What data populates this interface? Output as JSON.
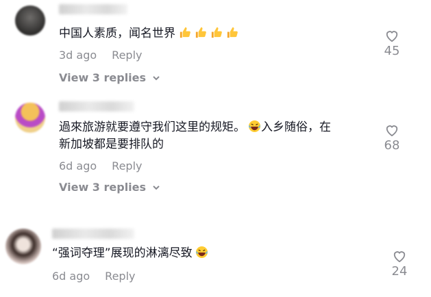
{
  "comments": [
    {
      "text": "中国人素质，闻名世界",
      "time": "3d ago",
      "reply_label": "Reply",
      "likes": "45",
      "view_replies": "View 3 replies",
      "emoji": "thumbs-up x4"
    },
    {
      "text_line1": "過來旅游就要遵守我们这里的规矩。",
      "text_line1b": "入乡随俗，在",
      "text_line2": "新加坡都是要排队的",
      "time": "6d ago",
      "reply_label": "Reply",
      "likes": "68",
      "view_replies": "View 3 replies",
      "emoji": "laughing-face"
    },
    {
      "text": "“强词夺理”展现的淋漓尽致",
      "time": "6d ago",
      "reply_label": "Reply",
      "likes": "24",
      "emoji": "laughing-face"
    }
  ],
  "colors": {
    "text": "#161823",
    "secondary": "#8a8b91",
    "background": "#ffffff"
  }
}
